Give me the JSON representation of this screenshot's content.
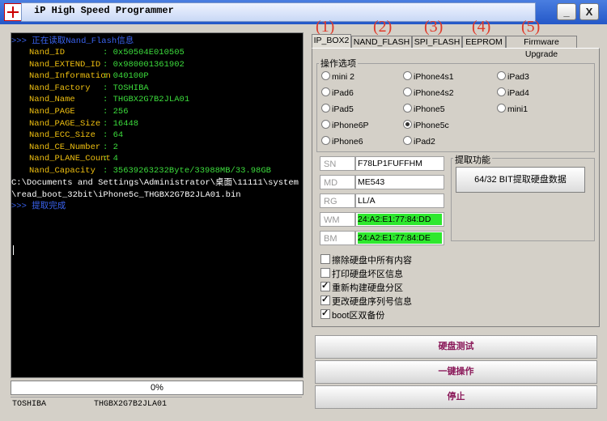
{
  "window": {
    "title": "iP High Speed Programmer",
    "minimize": "_",
    "close": "X"
  },
  "console": {
    "header": ">>> 正在读取Nand_Flash信息",
    "fields": [
      {
        "label": "Nand_ID",
        "value": ": 0x50504E010505"
      },
      {
        "label": "Nand_EXTEND_ID",
        "value": ": 0x980001361902"
      },
      {
        "label": "Nand_Information",
        "value": ": 040100P"
      },
      {
        "label": "Nand_Factory",
        "value": ": TOSHIBA"
      },
      {
        "label": "Nand_Name",
        "value": ": THGBX2G7B2JLA01"
      },
      {
        "label": "Nand_PAGE",
        "value": ": 256"
      },
      {
        "label": "Nand_PAGE_Size",
        "value": ": 16448"
      },
      {
        "label": "Nand_ECC_Size",
        "value": ": 64"
      },
      {
        "label": "Nand_CE_Number",
        "value": ": 2"
      },
      {
        "label": "Nand_PLANE_Count",
        "value": ": 4"
      },
      {
        "label": "Nand_Capacity",
        "value": ": 35639263232Byte/33988MB/33.98GB"
      }
    ],
    "path1": "C:\\Documents and Settings\\Administrator\\桌面\\11111\\system",
    "path2": "\\read_boot_32bit\\iPhone5c_THGBX2G7B2JLA01.bin",
    "done": ">>> 提取完成"
  },
  "progress": {
    "text": "0%",
    "fraction": 0
  },
  "statusbar": {
    "factory": "TOSHIBA",
    "name": "THGBX2G7B2JLA01"
  },
  "tab_numbers": [
    "(1)",
    "(2)",
    "(3)",
    "(4)",
    "(5)"
  ],
  "tabs": [
    "IP_BOX2",
    "NAND_FLASH",
    "SPI_FLASH",
    "EEPROM",
    "Firmware Upgrade"
  ],
  "options": {
    "group_label": "操作选项",
    "radios": [
      "mini 2",
      "iPhone4s1",
      "iPad3",
      "iPad6",
      "iPhone4s2",
      "iPad4",
      "iPad5",
      "iPhone5",
      "mini1",
      "iPhone6P",
      "iPhone5c",
      "iPhone6",
      "iPad2"
    ],
    "selected": "iPhone5c"
  },
  "info_fields": [
    {
      "label": "SN",
      "value": "F78LP1FUFFHM",
      "highlight": false
    },
    {
      "label": "MD",
      "value": "ME543",
      "highlight": false
    },
    {
      "label": "RG",
      "value": "LL/A",
      "highlight": false
    },
    {
      "label": "WM",
      "value": "24:A2:E1:77:84:DD",
      "highlight": true
    },
    {
      "label": "BM",
      "value": "24:A2:E1:77:84:DE",
      "highlight": true
    }
  ],
  "extract": {
    "group_label": "提取功能",
    "button": "64/32 BIT提取硬盘数据"
  },
  "checkboxes": [
    {
      "label": "擦除硬盘中所有内容",
      "checked": false
    },
    {
      "label": "打印硬盘坏区信息",
      "checked": false
    },
    {
      "label": "重新构建硬盘分区",
      "checked": true
    },
    {
      "label": "更改硬盘序列号信息",
      "checked": true
    },
    {
      "label": "boot区双备份",
      "checked": true
    }
  ],
  "buttons": {
    "test": "硬盘测试",
    "one_key": "一键操作",
    "stop": "停止"
  },
  "colors": {
    "titlebar": "#2458c8",
    "console_bg": "#000000",
    "label_yellow": "#f0c010",
    "value_green": "#3cdc3c",
    "header_blue": "#3a63f0",
    "mac_highlight": "#2ee82e",
    "tab_number_red": "#e03a2a",
    "button_text": "#8b1a5a"
  }
}
